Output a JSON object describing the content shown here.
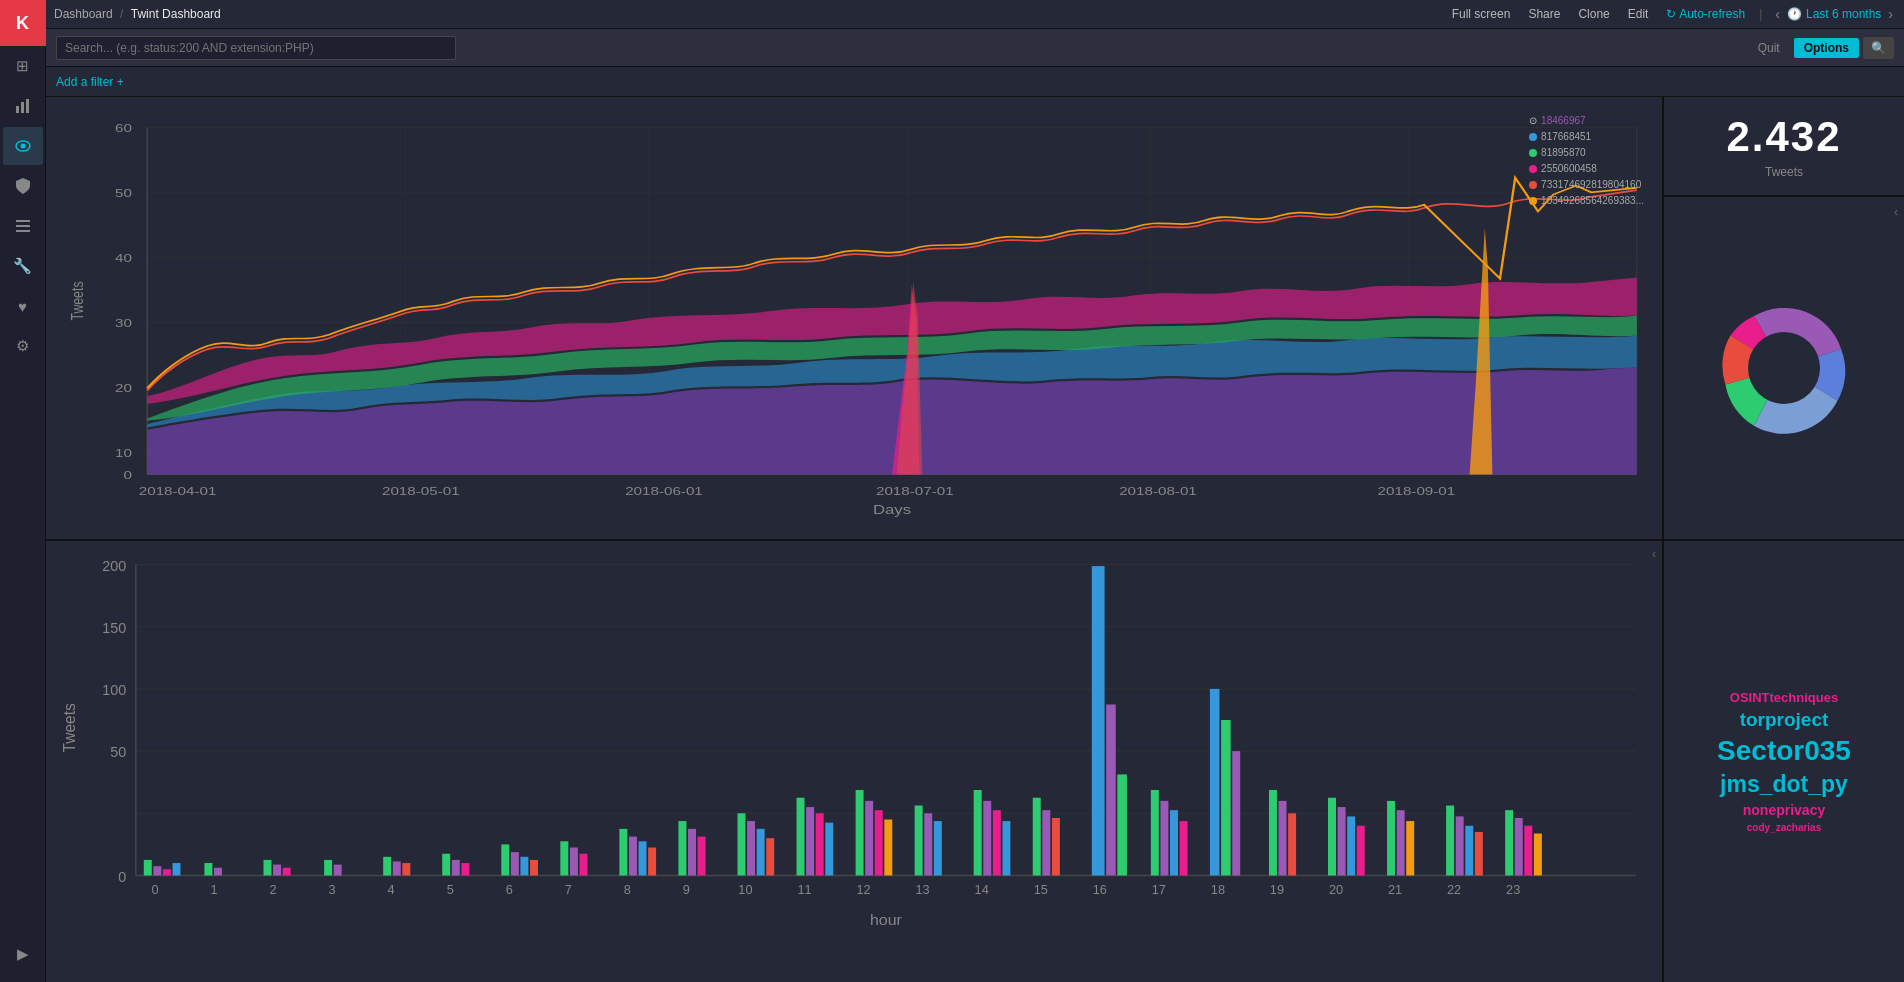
{
  "sidebar": {
    "logo": "K",
    "icons": [
      {
        "name": "home-icon",
        "symbol": "⊞"
      },
      {
        "name": "bar-chart-icon",
        "symbol": "▦"
      },
      {
        "name": "eye-icon",
        "symbol": "◎",
        "active": true
      },
      {
        "name": "shield-icon",
        "symbol": "⛉"
      },
      {
        "name": "list-icon",
        "symbol": "≡"
      },
      {
        "name": "wrench-icon",
        "symbol": "🔧"
      },
      {
        "name": "heart-icon",
        "symbol": "♥"
      },
      {
        "name": "gear-icon",
        "symbol": "⚙"
      },
      {
        "name": "arrow-icon",
        "symbol": "▶"
      }
    ]
  },
  "topbar": {
    "breadcrumb": {
      "parent": "Dashboard",
      "separator": "/",
      "current": "Twint Dashboard"
    },
    "actions": {
      "full_screen": "Full screen",
      "share": "Share",
      "clone": "Clone",
      "edit": "Edit",
      "auto_refresh": "Auto-refresh",
      "quit": "Quit",
      "options": "Options",
      "time_label": "Last 6 months"
    }
  },
  "searchbar": {
    "placeholder": "Search... (e.g. status:200 AND extension:PHP)"
  },
  "filterbar": {
    "add_filter": "Add a filter +"
  },
  "top_chart": {
    "title": "Days",
    "y_label": "Tweets",
    "legend": [
      {
        "id": "18466967",
        "color": "#9b59b6"
      },
      {
        "id": "817668451",
        "color": "#3498db"
      },
      {
        "id": "81895870",
        "color": "#2ecc71"
      },
      {
        "id": "2550600458",
        "color": "#e91e63"
      },
      {
        "id": "733174692819804160",
        "color": "#e74c3c"
      },
      {
        "id": "10349268564269383...",
        "color": "#f39c12"
      }
    ],
    "x_labels": [
      "2018-04-01",
      "2018-05-01",
      "2018-06-01",
      "2018-07-01",
      "2018-08-01",
      "2018-09-01"
    ],
    "y_max": 60
  },
  "tweets_count": {
    "value": "2.432",
    "label": "Tweets"
  },
  "bottom_chart": {
    "title": "hour",
    "y_label": "Tweets",
    "x_labels": [
      "0",
      "1",
      "2",
      "3",
      "4",
      "5",
      "6",
      "7",
      "8",
      "9",
      "10",
      "11",
      "12",
      "13",
      "14",
      "15",
      "16",
      "17",
      "18",
      "19",
      "20",
      "21",
      "22",
      "23"
    ],
    "y_max": 200
  },
  "word_cloud": {
    "words": [
      {
        "text": "OSINTtechniques",
        "size": 14,
        "color": "#e91e63"
      },
      {
        "text": "torproject",
        "size": 20,
        "color": "#00bcd4"
      },
      {
        "text": "Sector035",
        "size": 28,
        "color": "#00bcd4"
      },
      {
        "text": "jms_dot_py",
        "size": 24,
        "color": "#00bcd4"
      },
      {
        "text": "noneprivacy",
        "size": 16,
        "color": "#e91e63"
      },
      {
        "text": "cody_zacharias",
        "size": 11,
        "color": "#e91e63"
      }
    ]
  }
}
